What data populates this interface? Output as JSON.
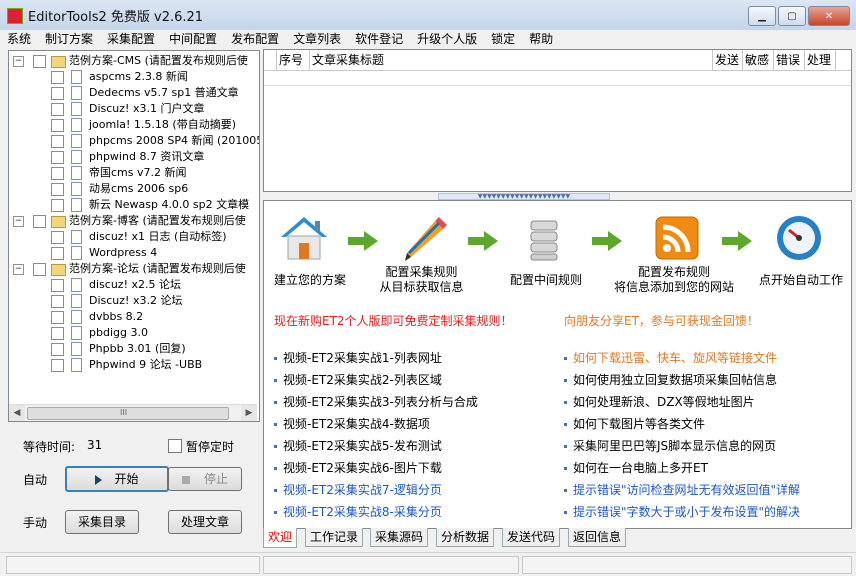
{
  "window": {
    "title": "EditorTools2 免费版 v2.6.21",
    "controls": [
      "minimize",
      "maximize",
      "close"
    ]
  },
  "menu": [
    "系统",
    "制订方案",
    "采集配置",
    "中间配置",
    "发布配置",
    "文章列表",
    "软件登记",
    "升级个人版",
    "锁定",
    "帮助"
  ],
  "tree": {
    "groups": [
      {
        "label": "范例方案-CMS (请配置发布规则后使",
        "items": [
          "aspcms 2.3.8 新闻",
          "Dedecms v5.7 sp1 普通文章",
          "Discuz! x3.1 门户文章",
          "joomla! 1.5.18 (带自动摘要)",
          "phpcms 2008 SP4 新闻 (201005",
          "phpwind 8.7 资讯文章",
          "帝国cms v7.2 新闻",
          "动易cms 2006 sp6",
          "新云 Newasp 4.0.0 sp2 文章模"
        ]
      },
      {
        "label": "范例方案-博客 (请配置发布规则后使",
        "items": [
          "discuz! x1 日志 (自动标签)",
          "Wordpress 4"
        ]
      },
      {
        "label": "范例方案-论坛 (请配置发布规则后使",
        "items": [
          "discuz! x2.5 论坛",
          "Discuz! x3.2 论坛",
          "dvbbs 8.2",
          "pbdigg 3.0",
          "Phpbb 3.01 (回复)",
          "Phpwind 9 论坛 -UBB"
        ]
      }
    ],
    "scroll_grip": "III"
  },
  "controls": {
    "wait_label": "等待时间:",
    "wait_value": "31",
    "pause_label": "暂停定时",
    "auto_label": "自动",
    "start_button": "开始",
    "stop_button": "停止",
    "manual_label": "手动",
    "collect_button": "采集目录",
    "process_button": "处理文章"
  },
  "grid": {
    "columns": [
      "序号",
      "文章采集标题",
      "发送",
      "敏感",
      "错误",
      "处理"
    ]
  },
  "welcome": {
    "steps": [
      {
        "icon": "house-icon",
        "label1": "建立您的方案",
        "label2": ""
      },
      {
        "icon": "pencil-icon",
        "label1": "配置采集规则",
        "label2": "从目标获取信息"
      },
      {
        "icon": "database-icon",
        "label1": "配置中间规则",
        "label2": ""
      },
      {
        "icon": "rss-icon",
        "label1": "配置发布规则",
        "label2": "将信息添加到您的网站"
      },
      {
        "icon": "gauge-icon",
        "label1": "点开始自动工作",
        "label2": ""
      }
    ],
    "promo_left": "现在新购ET2个人版即可免费定制采集规则！",
    "promo_right": "向朋友分享ET，参与可获现金回馈！",
    "links_left": [
      "视频-ET2采集实战1-列表网址",
      "视频-ET2采集实战2-列表区域",
      "视频-ET2采集实战3-列表分析与合成",
      "视频-ET2采集实战4-数据项",
      "视频-ET2采集实战5-发布测试",
      "视频-ET2采集实战6-图片下载",
      "视频-ET2采集实战7-逻辑分页",
      "视频-ET2采集实战8-采集分页"
    ],
    "links_right": [
      "如何下载迅雷、快车、旋风等链接文件",
      "如何使用独立回复数据项采集回帖信息",
      "如何处理新浪、DZX等假地址图片",
      "如何下载图片等各类文件",
      "采集阿里巴巴等JS脚本显示信息的网页",
      "如何在一台电脑上多开ET",
      "提示错误\"访问检查网址无有效返回值\"详解",
      "提示错误\"字数大于或小于发布设置\"的解决"
    ]
  },
  "tabs": [
    "欢迎",
    "工作记录",
    "采集源码",
    "分析数据",
    "发送代码",
    "返回信息"
  ],
  "colors": {
    "promo_left": "#e02020",
    "promo_right": "#e07820",
    "link_normal": "#000000",
    "link_highlight_orange": "#e07820",
    "link_blue": "#1a56c8",
    "arrow_green": "#5da82a",
    "active_tab_text": "#e00000"
  }
}
